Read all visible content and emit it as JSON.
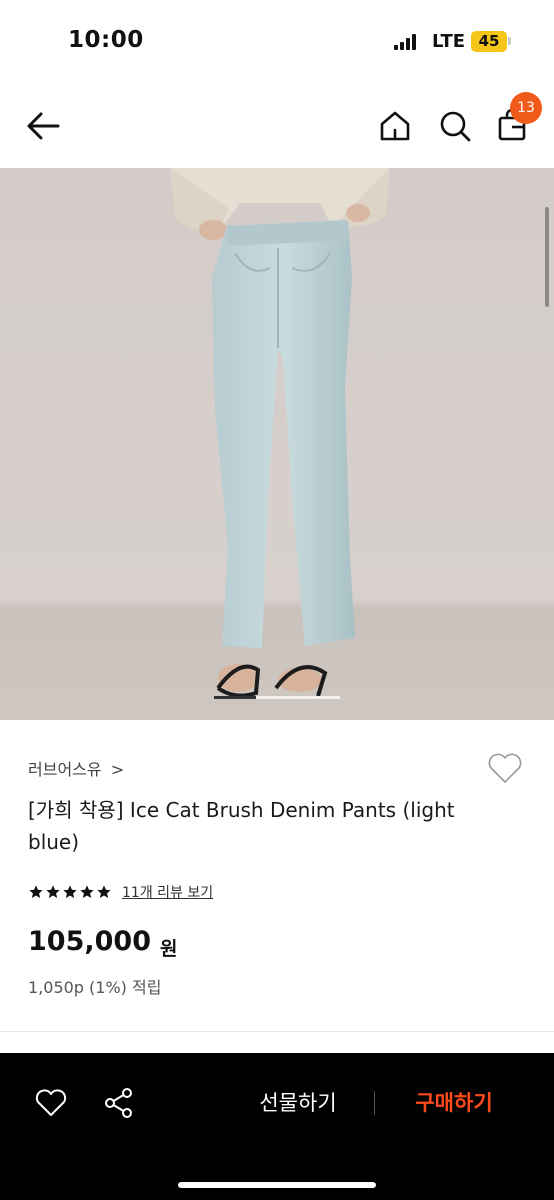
{
  "status_bar": {
    "time": "10:00",
    "network": "LTE",
    "battery": "45"
  },
  "nav": {
    "back_icon": "arrow-left-icon",
    "home_icon": "home-icon",
    "search_icon": "search-icon",
    "bag_icon": "shopping-bag-icon",
    "cart_count": "13"
  },
  "carousel": {
    "current": 1,
    "total": 3
  },
  "product": {
    "brand": "러브어스유",
    "brand_chevron": ">",
    "title": "[가희 착용] Ice Cat Brush Denim Pants (light blue)",
    "rating_stars": 5,
    "review_link": "11개 리뷰 보기",
    "price": "105,000",
    "price_unit": "원",
    "points": "1,050p (1%) 적립"
  },
  "action_bar": {
    "wish_icon": "heart-icon",
    "share_icon": "share-icon",
    "gift_label": "선물하기",
    "buy_label": "구매하기"
  },
  "colors": {
    "accent": "#ff4a1c",
    "badge": "#f05a1a",
    "battery": "#f5c518",
    "bar_bg": "#000000"
  }
}
